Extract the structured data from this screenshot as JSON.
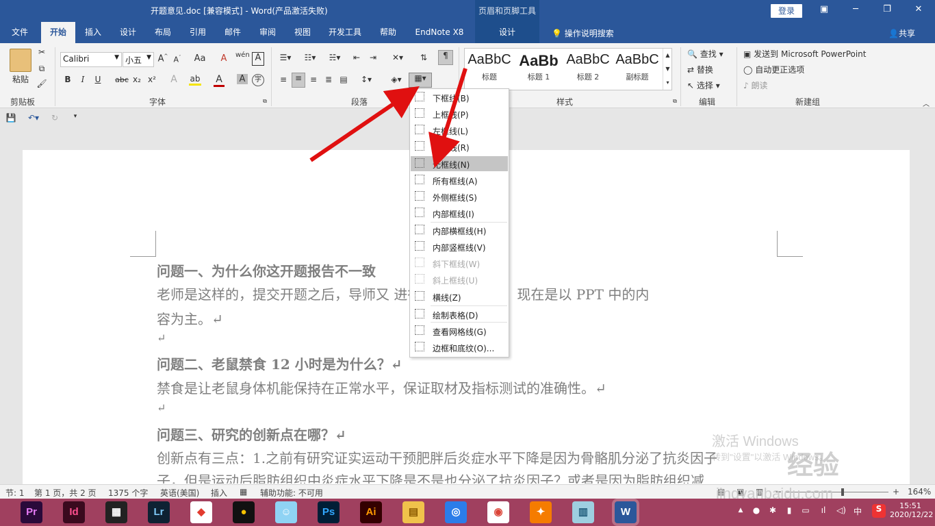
{
  "title": {
    "text": "开题意见.doc [兼容模式] - Word(产品激活失败)",
    "context_group": "页眉和页脚工具",
    "login": "登录"
  },
  "tabs": [
    "文件",
    "开始",
    "插入",
    "设计",
    "布局",
    "引用",
    "邮件",
    "审阅",
    "视图",
    "开发工具",
    "帮助",
    "EndNote X8"
  ],
  "context_tab": "设计",
  "tellme": "操作说明搜索",
  "share": "共享",
  "ribbon": {
    "clipboard": {
      "paste": "粘贴",
      "label": "剪贴板"
    },
    "font": {
      "name": "Calibri",
      "size": "小五",
      "label": "字体",
      "change_case": "Aa",
      "bold": "B",
      "italic": "I",
      "underline": "U",
      "strike": "abc",
      "sub": "x₂",
      "sup": "x²"
    },
    "paragraph": {
      "label": "段落"
    },
    "styles": {
      "label": "样式",
      "items": [
        {
          "sample": "AaBbC",
          "name": "标题"
        },
        {
          "sample": "AaBb",
          "name": "标题 1"
        },
        {
          "sample": "AaBbC",
          "name": "标题 2"
        },
        {
          "sample": "AaBbC",
          "name": "副标题"
        }
      ]
    },
    "editing": {
      "find": "查找",
      "replace": "替换",
      "select": "选择",
      "label": "编辑"
    },
    "newgroup": {
      "ppt": "发送到 Microsoft PowerPoint",
      "autocorrect": "自动更正选项",
      "read": "朗读",
      "label": "新建组"
    }
  },
  "menu": {
    "items": [
      {
        "label": "下框线(B)",
        "state": "normal"
      },
      {
        "label": "上框线(P)",
        "state": "normal"
      },
      {
        "label": "左框线(L)",
        "state": "normal"
      },
      {
        "label": "右框线(R)",
        "state": "normal"
      },
      {
        "label": "无框线(N)",
        "state": "highlight"
      },
      {
        "label": "所有框线(A)",
        "state": "normal"
      },
      {
        "label": "外侧框线(S)",
        "state": "normal"
      },
      {
        "label": "内部框线(I)",
        "state": "normal"
      },
      {
        "label": "内部横框线(H)",
        "state": "normal"
      },
      {
        "label": "内部竖框线(V)",
        "state": "normal"
      },
      {
        "label": "斜下框线(W)",
        "state": "disabled"
      },
      {
        "label": "斜上框线(U)",
        "state": "disabled"
      },
      {
        "label": "横线(Z)",
        "state": "normal"
      },
      {
        "label": "绘制表格(D)",
        "state": "normal"
      },
      {
        "label": "查看网格线(G)",
        "state": "normal"
      },
      {
        "label": "边框和底纹(O)...",
        "state": "normal"
      }
    ]
  },
  "document": {
    "lines": [
      {
        "text": "问题一、为什么你这开题报告不一致",
        "bold": true
      },
      {
        "text": "老师是这样的，提交开题之后，导师又         进行了指导和修改，现在是以 PPT 中的内",
        "bold": false
      },
      {
        "text": "容为主。↵",
        "bold": false
      },
      {
        "text": "↵",
        "bold": false
      },
      {
        "text": "问题二、老鼠禁食 12 小时是为什么？↵",
        "bold": true
      },
      {
        "text": "禁食是让老鼠身体机能保持在正常水平，保证取材及指标测试的准确性。↵",
        "bold": false
      },
      {
        "text": "↵",
        "bold": false
      },
      {
        "text": "问题三、研究的创新点在哪？↵",
        "bold": true
      },
      {
        "text": "创新点有三点：1.之前有研究证实运动干预肥胖后炎症水平下降是因为骨骼肌分泌了抗炎因子",
        "bold": false
      },
      {
        "text": "子，但是运动后脂肪组织中炎症水平下降是不是也分泌了抗炎因子？或者是因为脂肪组织减",
        "bold": false
      }
    ]
  },
  "status": {
    "section": "节: 1",
    "page": "第 1 页，共 2 页",
    "words": "1375 个字",
    "lang": "英语(美国)",
    "mode": "插入",
    "accessibility": "辅助功能: 不可用",
    "zoom": "164%",
    "zoom_fraction": 0.55
  },
  "watermark": {
    "activate": "激活 Windows",
    "activate_sub": "转到\"设置\"以激活 Windows。",
    "site": "jingyanbaidu.com",
    "brand": "经验"
  },
  "taskbar": {
    "apps": [
      {
        "icon": "premiere-icon",
        "text": "Pr",
        "color": "#2a0a3a",
        "fg": "#e77cf6"
      },
      {
        "icon": "indesign-icon",
        "text": "Id",
        "color": "#3a0a1e",
        "fg": "#ff4f8f"
      },
      {
        "icon": "video-editor-icon",
        "text": "▦",
        "color": "#222222",
        "fg": "#ffffff"
      },
      {
        "icon": "lightroom-icon",
        "text": "Lr",
        "color": "#0e2233",
        "fg": "#7ec8f6"
      },
      {
        "icon": "app-colorful-icon",
        "text": "◆",
        "color": "#ffffff",
        "fg": "#e23b2e"
      },
      {
        "icon": "qq-icon",
        "text": "●",
        "color": "#111111",
        "fg": "#f7c300"
      },
      {
        "icon": "chat-app-icon",
        "text": "☺",
        "color": "#8fd3f4",
        "fg": "#ffffff"
      },
      {
        "icon": "photoshop-icon",
        "text": "Ps",
        "color": "#001e36",
        "fg": "#31a8ff"
      },
      {
        "icon": "illustrator-icon",
        "text": "Ai",
        "color": "#330000",
        "fg": "#ff9a00"
      },
      {
        "icon": "file-explorer-icon",
        "text": "▤",
        "color": "#f0c24b",
        "fg": "#8a5a00"
      },
      {
        "icon": "browser-icon",
        "text": "◎",
        "color": "#2b7de9",
        "fg": "#ffffff"
      },
      {
        "icon": "chrome-icon",
        "text": "◉",
        "color": "#ffffff",
        "fg": "#db4437"
      },
      {
        "icon": "bird-app-icon",
        "text": "✦",
        "color": "#f57c00",
        "fg": "#ffffff"
      },
      {
        "icon": "notes-app-icon",
        "text": "▥",
        "color": "#9ecfe0",
        "fg": "#1f5c7a"
      },
      {
        "icon": "word-icon",
        "text": "W",
        "color": "#2b579a",
        "fg": "#ffffff"
      }
    ],
    "ime": "中",
    "time": "15:51",
    "date": "2020/12/22"
  }
}
